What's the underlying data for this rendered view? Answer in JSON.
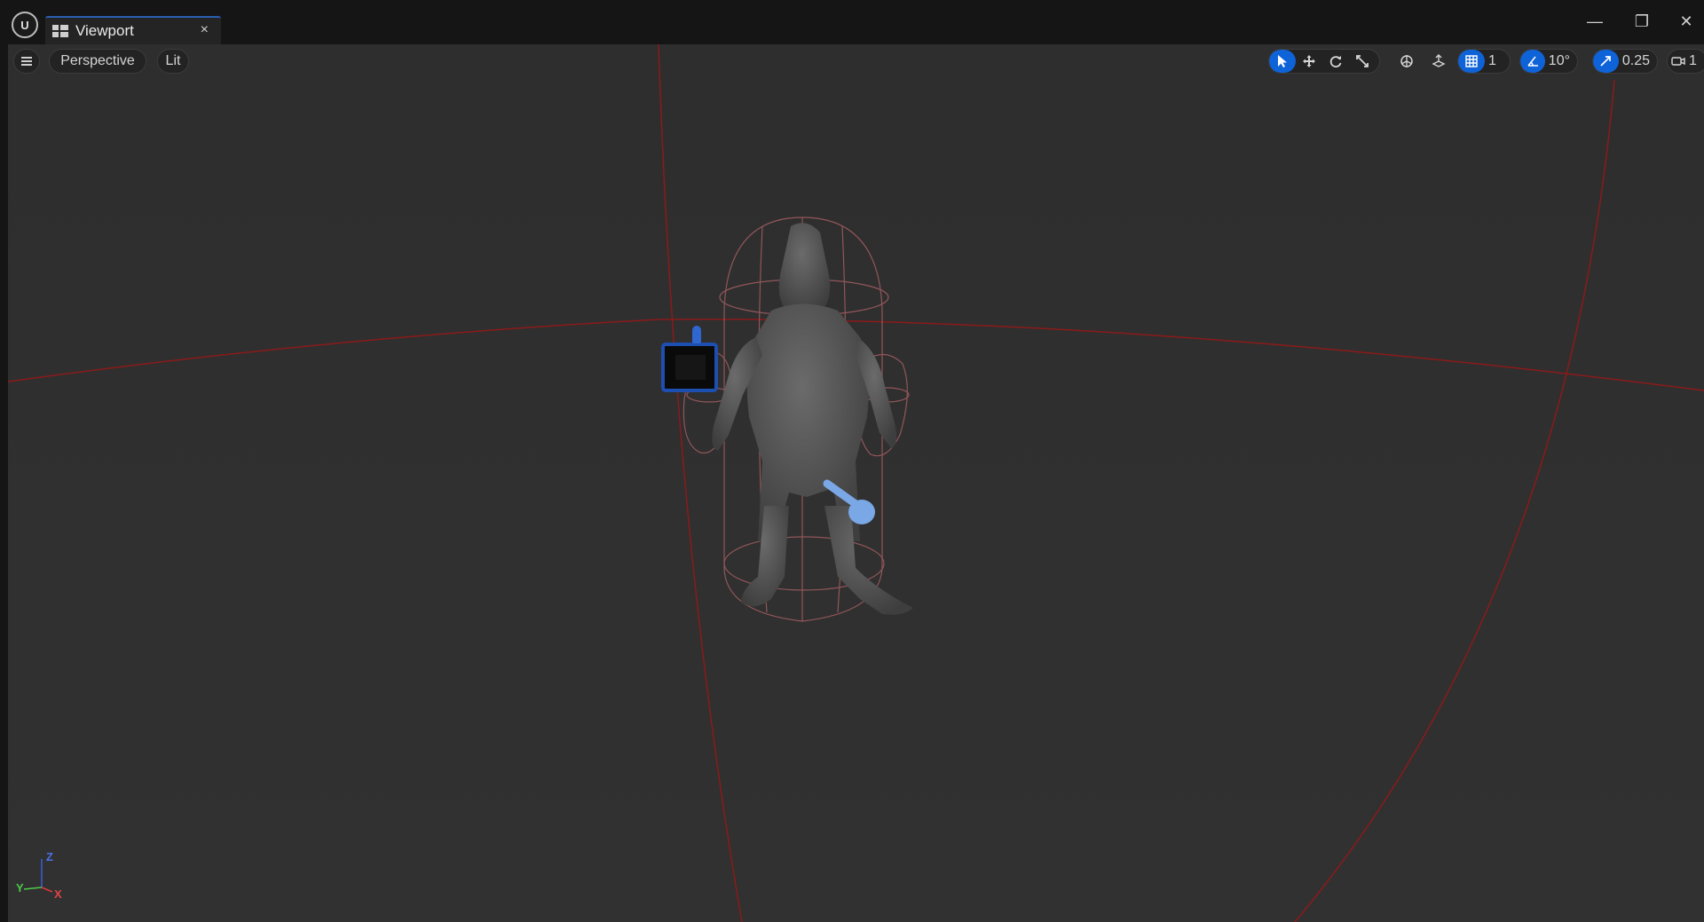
{
  "window": {
    "tab_label": "Viewport",
    "tab_close": "×",
    "minimize": "—",
    "restore": "❐",
    "close": "✕"
  },
  "toolbar": {
    "view_mode": "Perspective",
    "lighting": "Lit",
    "grid_snap_value": "1",
    "rotation_snap_value": "10°",
    "scale_snap_value": "0.25",
    "camera_speed_value": "1"
  },
  "axes": {
    "z": "Z",
    "y": "Y",
    "x": "X"
  },
  "colors": {
    "accent": "#0f63d8",
    "viewport_bg": "#2f2f2f",
    "bounds_line": "#8b1a1a",
    "capsule_wire": "#b56a6a"
  }
}
